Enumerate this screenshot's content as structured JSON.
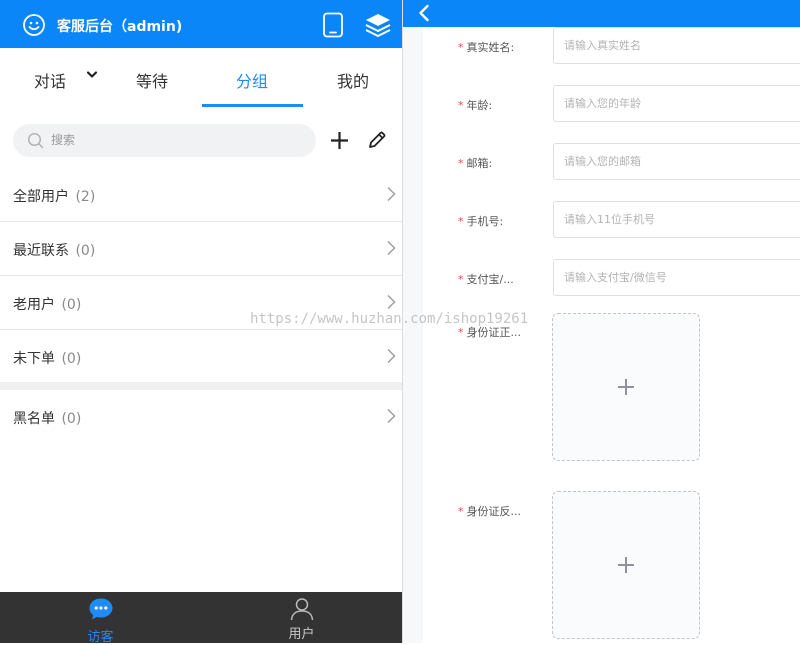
{
  "header": {
    "title": "客服后台（admin)",
    "bg_color": "#0a86f9",
    "icons": [
      "smiley-logo-icon",
      "tablet-icon",
      "layers-icon"
    ]
  },
  "tabs": [
    {
      "label": "对话",
      "has_dropdown": true
    },
    {
      "label": "等待"
    },
    {
      "label": "分组",
      "active": true
    },
    {
      "label": "我的"
    }
  ],
  "search": {
    "placeholder": "搜索"
  },
  "groups": [
    {
      "name": "全部用户",
      "count": "(2)"
    },
    {
      "name": "最近联系",
      "count": "(0)"
    },
    {
      "name": "老用户",
      "count": "(0)"
    },
    {
      "name": "未下单",
      "count": "(0)"
    },
    {
      "name": "黑名单",
      "count": "(0)"
    }
  ],
  "bottom_nav": [
    {
      "label": "访客",
      "icon": "chat-bubble-icon",
      "active": true
    },
    {
      "label": "用户",
      "icon": "user-icon"
    }
  ],
  "form": {
    "fields": [
      {
        "label": "真实姓名:",
        "placeholder": "请输入真实姓名"
      },
      {
        "label": "年龄:",
        "placeholder": "请输入您的年龄"
      },
      {
        "label": "邮箱:",
        "placeholder": "请输入您的邮箱"
      },
      {
        "label": "手机号:",
        "placeholder": "请输入11位手机号"
      },
      {
        "label": "支付宝/...",
        "placeholder": "请输入支付宝/微信号"
      }
    ],
    "uploads": [
      {
        "label": "身份证正..."
      },
      {
        "label": "身份证反..."
      }
    ],
    "required_mark": "*"
  },
  "watermark": "https://www.huzhan.com/ishop19261",
  "colors": {
    "accent": "#1e8cf6",
    "bottom_bar": "#333333",
    "required": "#e64b4b"
  }
}
